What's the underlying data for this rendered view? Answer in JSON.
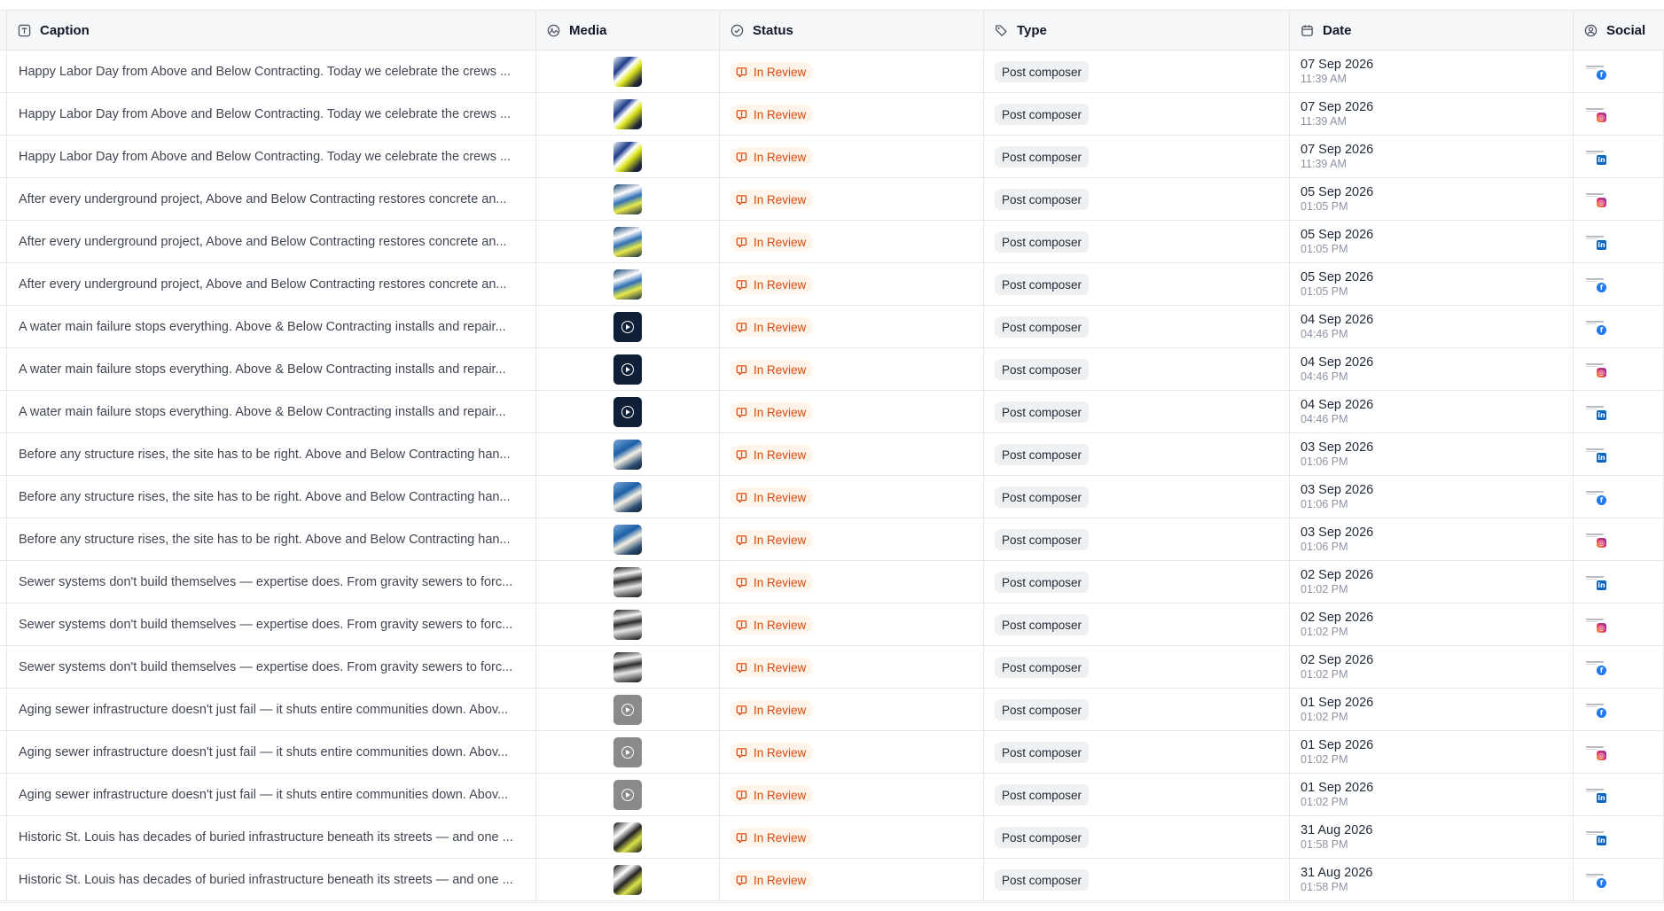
{
  "columns": {
    "caption": "Caption",
    "media": "Media",
    "status": "Status",
    "type": "Type",
    "date": "Date",
    "social": "Social"
  },
  "colors": {
    "status_text": "#d9480f",
    "status_bg": "#fff4ea",
    "facebook": "#1877f2",
    "linkedin": "#0a66c2"
  },
  "rows": [
    {
      "caption": "Happy Labor Day from Above and Below Contracting. Today we celebrate the crews ...",
      "media": "img-a",
      "status": "In Review",
      "type": "Post composer",
      "date": "07 Sep 2026",
      "time": "11:39 AM",
      "social": "facebook"
    },
    {
      "caption": "Happy Labor Day from Above and Below Contracting. Today we celebrate the crews ...",
      "media": "img-a",
      "status": "In Review",
      "type": "Post composer",
      "date": "07 Sep 2026",
      "time": "11:39 AM",
      "social": "instagram"
    },
    {
      "caption": "Happy Labor Day from Above and Below Contracting. Today we celebrate the crews ...",
      "media": "img-a",
      "status": "In Review",
      "type": "Post composer",
      "date": "07 Sep 2026",
      "time": "11:39 AM",
      "social": "linkedin"
    },
    {
      "caption": "After every underground project, Above and Below Contracting restores concrete an...",
      "media": "img-b",
      "status": "In Review",
      "type": "Post composer",
      "date": "05 Sep 2026",
      "time": "01:05 PM",
      "social": "instagram"
    },
    {
      "caption": "After every underground project, Above and Below Contracting restores concrete an...",
      "media": "img-b",
      "status": "In Review",
      "type": "Post composer",
      "date": "05 Sep 2026",
      "time": "01:05 PM",
      "social": "linkedin"
    },
    {
      "caption": "After every underground project, Above and Below Contracting restores concrete an...",
      "media": "img-b",
      "status": "In Review",
      "type": "Post composer",
      "date": "05 Sep 2026",
      "time": "01:05 PM",
      "social": "facebook"
    },
    {
      "caption": "A water main failure stops everything. Above & Below Contracting installs and repair...",
      "media": "vid-dark",
      "status": "In Review",
      "type": "Post composer",
      "date": "04 Sep 2026",
      "time": "04:46 PM",
      "social": "facebook"
    },
    {
      "caption": "A water main failure stops everything. Above & Below Contracting installs and repair...",
      "media": "vid-dark",
      "status": "In Review",
      "type": "Post composer",
      "date": "04 Sep 2026",
      "time": "04:46 PM",
      "social": "instagram"
    },
    {
      "caption": "A water main failure stops everything. Above & Below Contracting installs and repair...",
      "media": "vid-dark",
      "status": "In Review",
      "type": "Post composer",
      "date": "04 Sep 2026",
      "time": "04:46 PM",
      "social": "linkedin"
    },
    {
      "caption": "Before any structure rises, the site has to be right. Above and Below Contracting han...",
      "media": "img-c",
      "status": "In Review",
      "type": "Post composer",
      "date": "03 Sep 2026",
      "time": "01:06 PM",
      "social": "linkedin"
    },
    {
      "caption": "Before any structure rises, the site has to be right. Above and Below Contracting han...",
      "media": "img-c",
      "status": "In Review",
      "type": "Post composer",
      "date": "03 Sep 2026",
      "time": "01:06 PM",
      "social": "facebook"
    },
    {
      "caption": "Before any structure rises, the site has to be right. Above and Below Contracting han...",
      "media": "img-c",
      "status": "In Review",
      "type": "Post composer",
      "date": "03 Sep 2026",
      "time": "01:06 PM",
      "social": "instagram"
    },
    {
      "caption": "Sewer systems don't build themselves — expertise does. From gravity sewers to forc...",
      "media": "img-d",
      "status": "In Review",
      "type": "Post composer",
      "date": "02 Sep 2026",
      "time": "01:02 PM",
      "social": "linkedin"
    },
    {
      "caption": "Sewer systems don't build themselves — expertise does. From gravity sewers to forc...",
      "media": "img-d",
      "status": "In Review",
      "type": "Post composer",
      "date": "02 Sep 2026",
      "time": "01:02 PM",
      "social": "instagram"
    },
    {
      "caption": "Sewer systems don't build themselves — expertise does. From gravity sewers to forc...",
      "media": "img-d",
      "status": "In Review",
      "type": "Post composer",
      "date": "02 Sep 2026",
      "time": "01:02 PM",
      "social": "facebook"
    },
    {
      "caption": "Aging sewer infrastructure doesn't just fail — it shuts entire communities down. Abov...",
      "media": "vid-gray",
      "status": "In Review",
      "type": "Post composer",
      "date": "01 Sep 2026",
      "time": "01:02 PM",
      "social": "facebook"
    },
    {
      "caption": "Aging sewer infrastructure doesn't just fail — it shuts entire communities down. Abov...",
      "media": "vid-gray",
      "status": "In Review",
      "type": "Post composer",
      "date": "01 Sep 2026",
      "time": "01:02 PM",
      "social": "instagram"
    },
    {
      "caption": "Aging sewer infrastructure doesn't just fail — it shuts entire communities down. Abov...",
      "media": "vid-gray",
      "status": "In Review",
      "type": "Post composer",
      "date": "01 Sep 2026",
      "time": "01:02 PM",
      "social": "linkedin"
    },
    {
      "caption": "Historic St. Louis has decades of buried infrastructure beneath its streets — and one ...",
      "media": "img-e",
      "status": "In Review",
      "type": "Post composer",
      "date": "31 Aug 2026",
      "time": "01:58 PM",
      "social": "linkedin"
    },
    {
      "caption": "Historic St. Louis has decades of buried infrastructure beneath its streets — and one ...",
      "media": "img-e",
      "status": "In Review",
      "type": "Post composer",
      "date": "31 Aug 2026",
      "time": "01:58 PM",
      "social": "facebook"
    }
  ]
}
